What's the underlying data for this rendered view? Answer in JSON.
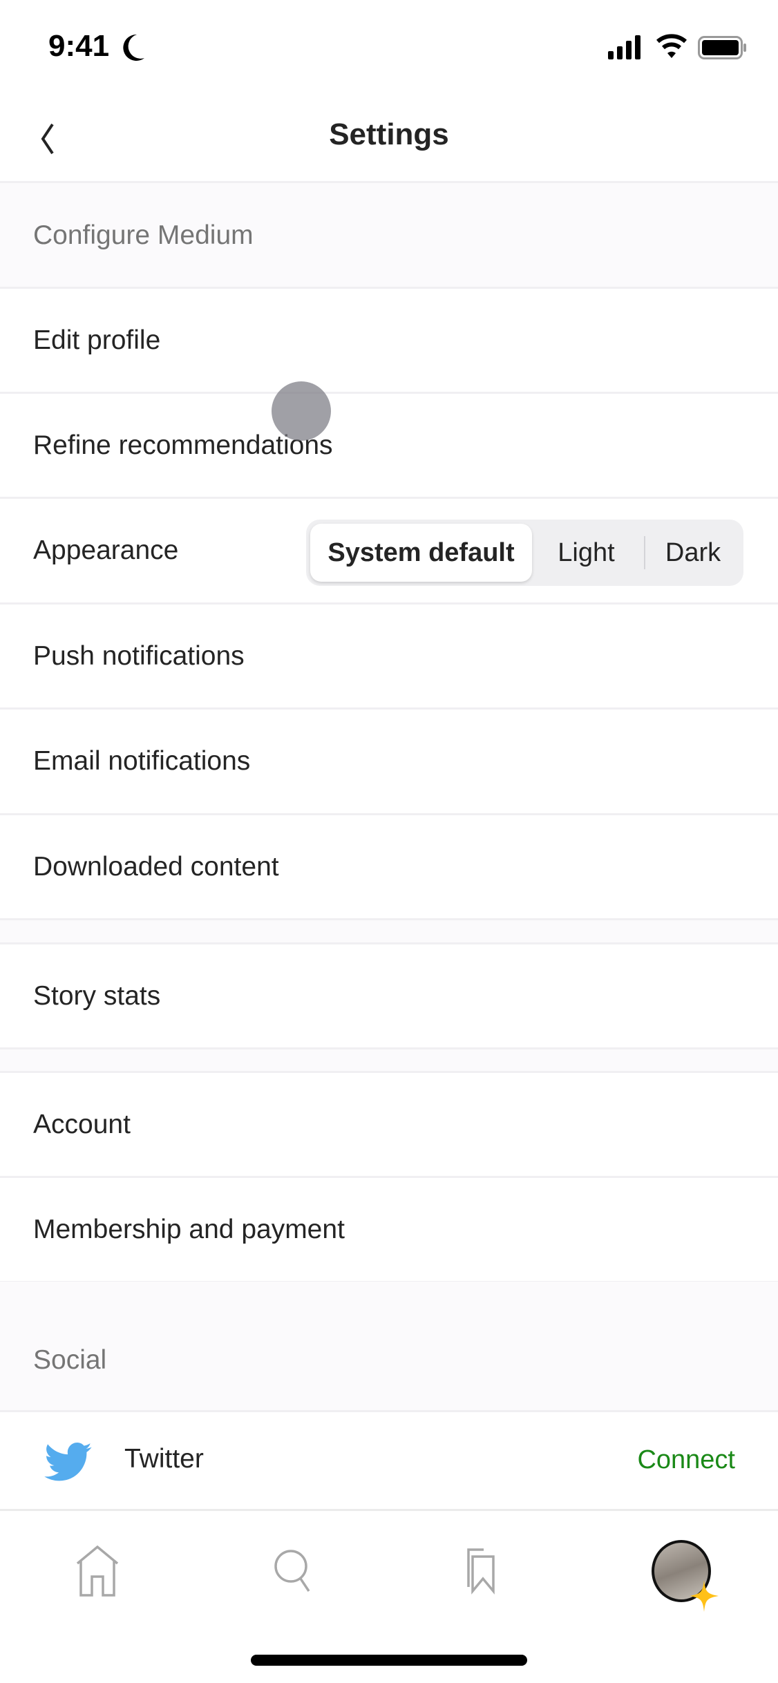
{
  "status_bar": {
    "time": "9:41",
    "icons": [
      "moon-icon",
      "cellular-icon",
      "wifi-icon",
      "battery-icon"
    ]
  },
  "header": {
    "title": "Settings",
    "back_icon": "chevron-left-icon"
  },
  "sections": {
    "configure": "Configure Medium",
    "social": "Social"
  },
  "rows": {
    "edit_profile": "Edit profile",
    "refine": "Refine recommendations",
    "appearance": "Appearance",
    "push": "Push notifications",
    "email": "Email notifications",
    "downloaded": "Downloaded content",
    "story_stats": "Story stats",
    "account": "Account",
    "membership": "Membership and payment"
  },
  "appearance_options": {
    "system": "System default",
    "light": "Light",
    "dark": "Dark",
    "selected": "System default"
  },
  "social": {
    "twitter": "Twitter",
    "connect": "Connect",
    "connect_color": "#1a8917",
    "twitter_color": "#55acee"
  },
  "tabbar": {
    "items": [
      "home-icon",
      "search-icon",
      "bookmarks-icon",
      "profile-avatar"
    ]
  }
}
